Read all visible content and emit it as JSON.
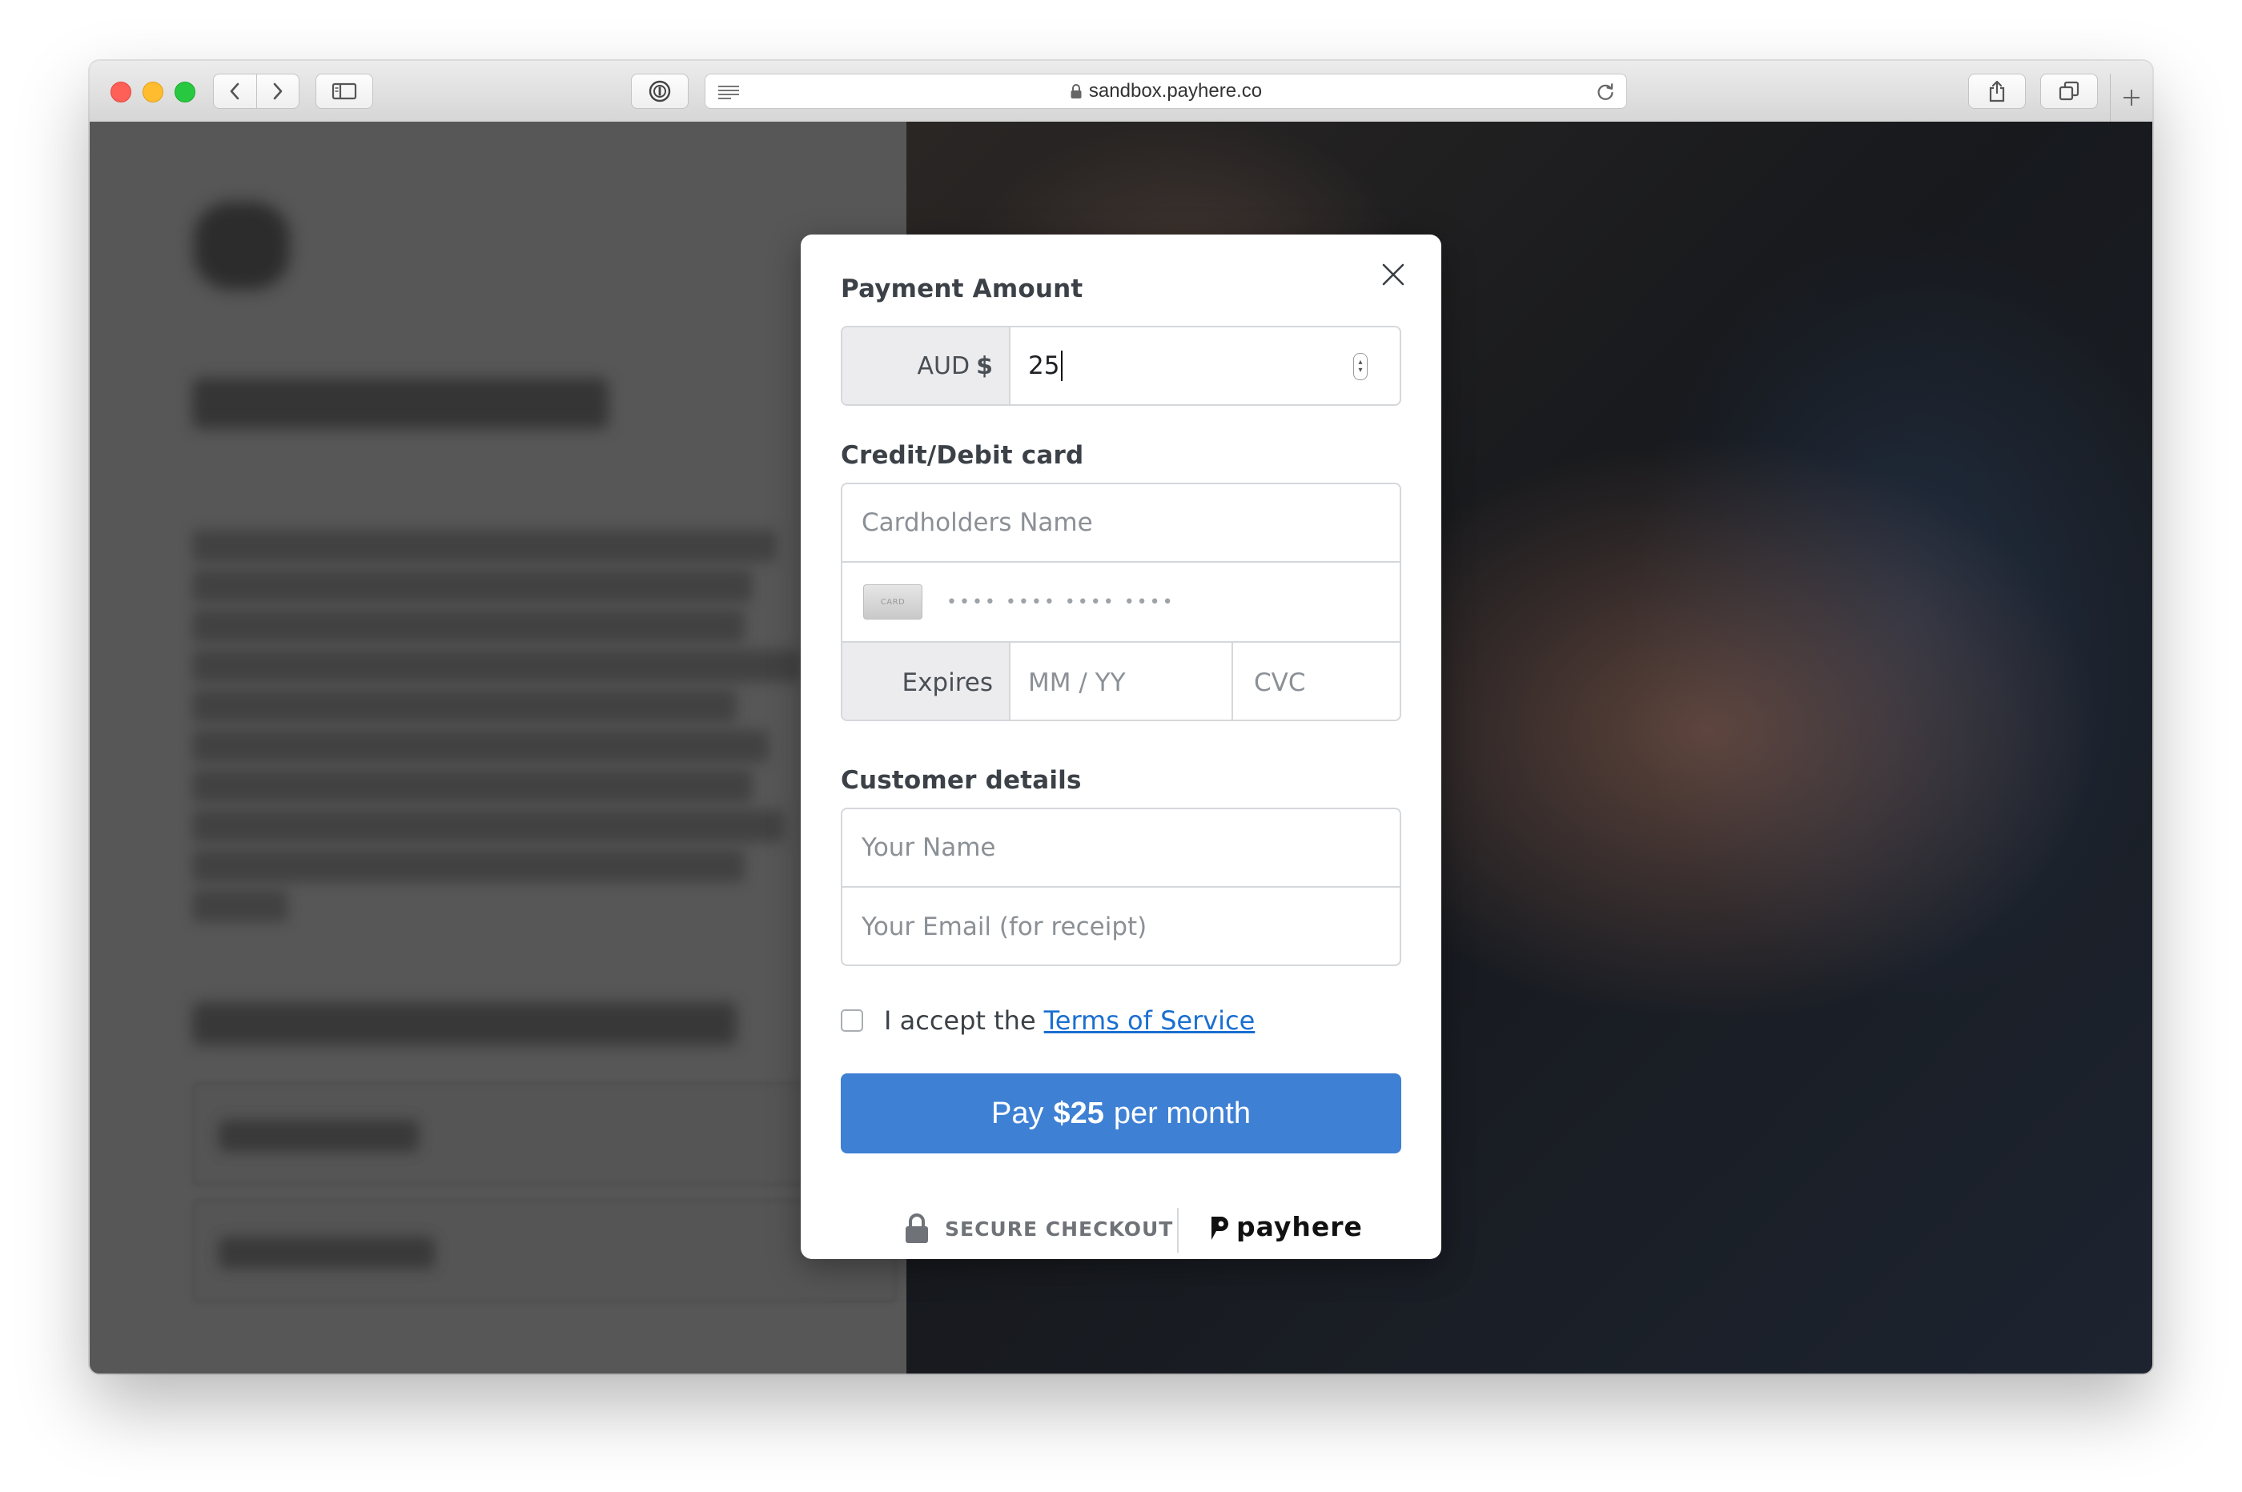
{
  "browser": {
    "url": "sandbox.payhere.co"
  },
  "modal": {
    "payment_amount_label": "Payment Amount",
    "currency": "AUD",
    "currency_symbol": "$",
    "amount_value": "25",
    "card_section_label": "Credit/Debit card",
    "cardholder_placeholder": "Cardholders Name",
    "card_icon_text": "CARD",
    "card_number_placeholder": "•••• •••• •••• ••••",
    "expires_label": "Expires",
    "expiry_placeholder": "MM / YY",
    "cvc_placeholder": "CVC",
    "customer_section_label": "Customer details",
    "name_placeholder": "Your Name",
    "email_placeholder": "Your Email (for receipt)",
    "terms_prefix": "I accept the",
    "terms_link": "Terms of Service",
    "pay_button": {
      "prefix": "Pay",
      "amount": "$25",
      "suffix": "per month",
      "color": "#3e80d4"
    },
    "secure_checkout": "SECURE CHECKOUT",
    "brand": "payhere"
  }
}
